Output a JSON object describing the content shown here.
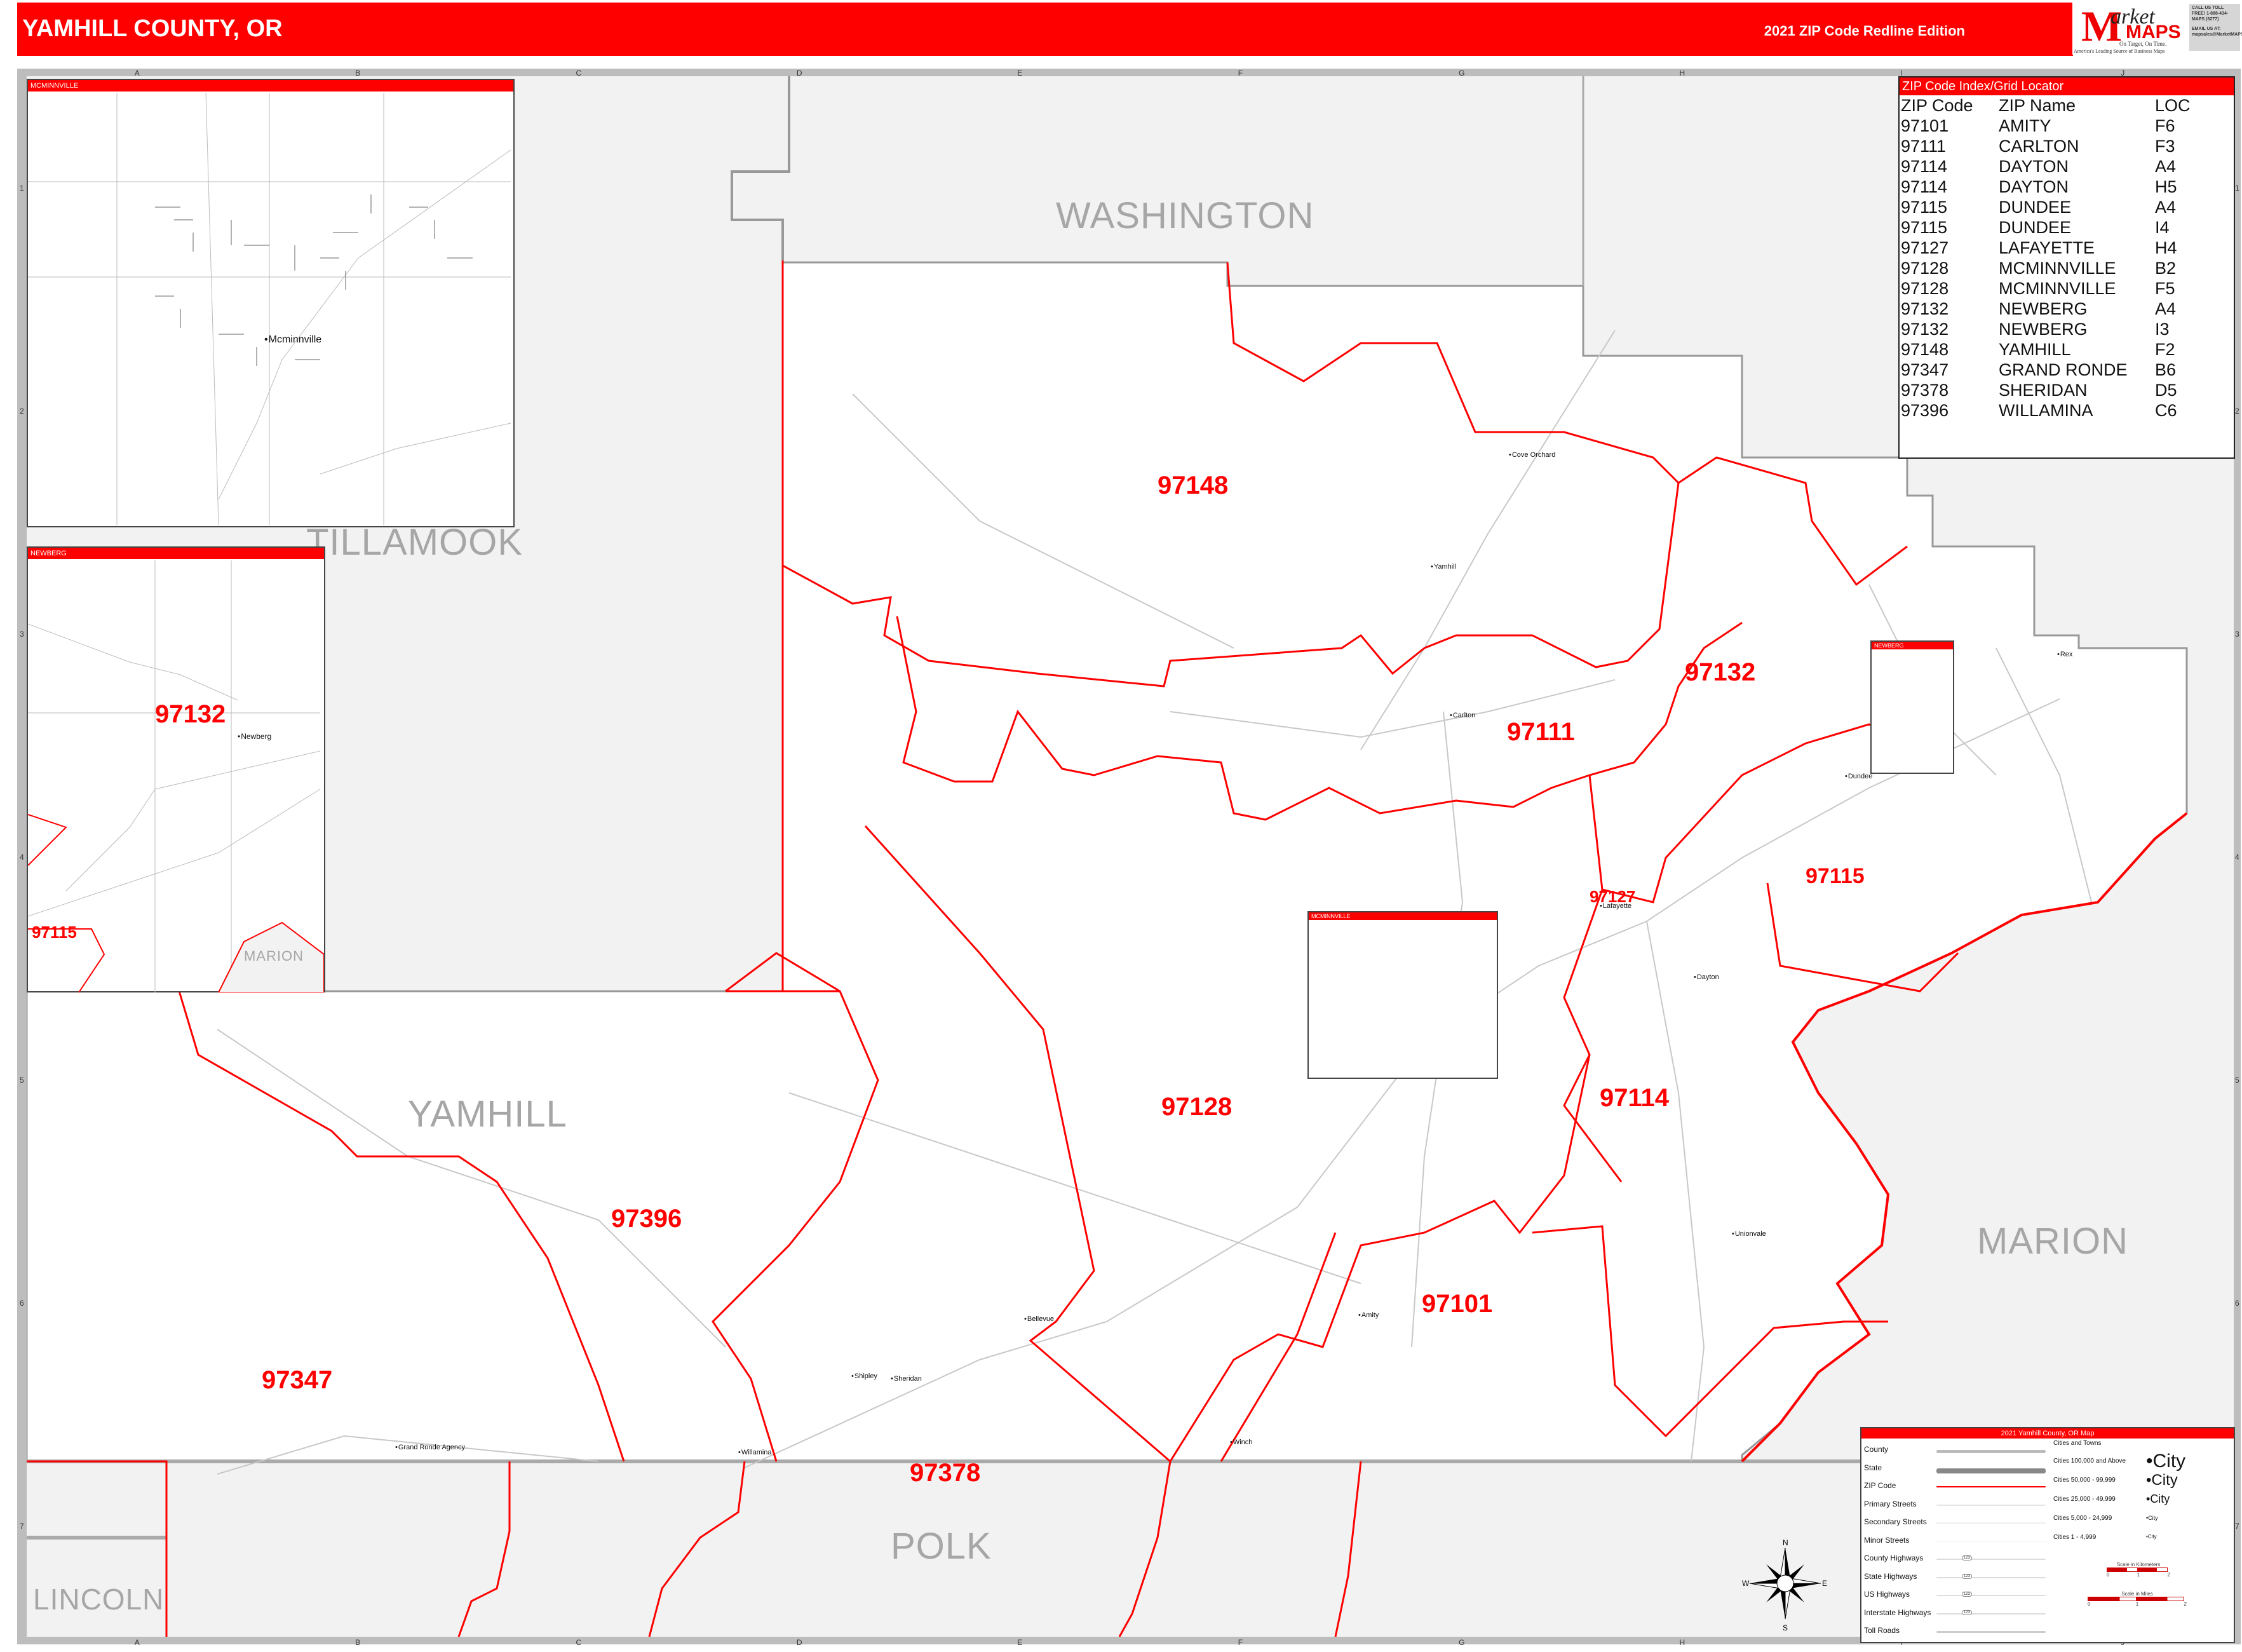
{
  "header": {
    "title": "YAMHILL COUNTY, OR",
    "edition": "2021 ZIP Code Redline Edition"
  },
  "logo": {
    "brand_m": "M",
    "brand_arket": "arket",
    "brand_maps": "MAPS",
    "tagline": "On Target, On Time.",
    "subtitle": "America's Leading Source of Business Maps",
    "contact_call": "CALL US TOLL FREE! 1-888-434-MAPS (6277)",
    "contact_email": "EMAIL US AT: mapsales@MarketMAPS.com"
  },
  "grid": {
    "columns": [
      "A",
      "B",
      "C",
      "D",
      "E",
      "F",
      "G",
      "H",
      "I",
      "J"
    ],
    "rows": [
      "1",
      "2",
      "3",
      "4",
      "5",
      "6",
      "7"
    ]
  },
  "counties": {
    "washington": "WASHINGTON",
    "tillamook": "TILLAMOOK",
    "yamhill": "YAMHILL",
    "marion": "MARION",
    "polk": "POLK",
    "lincoln": "LINCOLN",
    "marion_inset": "MARION"
  },
  "zip_labels": {
    "z97148": "97148",
    "z97132": "97132",
    "z97111": "97111",
    "z97127": "97127",
    "z97115": "97115",
    "z97128": "97128",
    "z97114": "97114",
    "z97396": "97396",
    "z97347": "97347",
    "z97101": "97101",
    "z97378": "97378",
    "inset_97132": "97132",
    "inset_97115": "97115"
  },
  "towns": {
    "cove_orchard": "Cove Orchard",
    "yamhill": "Yamhill",
    "carlton": "Carlton",
    "lafayette": "Lafayette",
    "dayton": "Dayton",
    "dundee": "Dundee",
    "rex": "Rex",
    "unionvale": "Unionvale",
    "amity": "Amity",
    "bellevue": "Bellevue",
    "sheridan": "Sheridan",
    "shipley": "Shipley",
    "willamina": "Willamina",
    "grand_ronde_agency": "Grand Ronde Agency",
    "winch": "Winch",
    "mcminnville": "Mcminnville",
    "newberg": "Newberg"
  },
  "insets": {
    "mcminnville_title": "MCMINNVILLE",
    "newberg_title": "NEWBERG",
    "mcminnville_locator": "MCMINNVILLE",
    "newberg_locator": "NEWBERG"
  },
  "zip_index": {
    "title": "ZIP Code Index/Grid Locator",
    "columns": [
      "ZIP Code",
      "ZIP Name",
      "LOC"
    ],
    "rows": [
      [
        "97101",
        "AMITY",
        "F6"
      ],
      [
        "97111",
        "CARLTON",
        "F3"
      ],
      [
        "97114",
        "DAYTON",
        "A4"
      ],
      [
        "97114",
        "DAYTON",
        "H5"
      ],
      [
        "97115",
        "DUNDEE",
        "A4"
      ],
      [
        "97115",
        "DUNDEE",
        "I4"
      ],
      [
        "97127",
        "LAFAYETTE",
        "H4"
      ],
      [
        "97128",
        "MCMINNVILLE",
        "B2"
      ],
      [
        "97128",
        "MCMINNVILLE",
        "F5"
      ],
      [
        "97132",
        "NEWBERG",
        "A4"
      ],
      [
        "97132",
        "NEWBERG",
        "I3"
      ],
      [
        "97148",
        "YAMHILL",
        "F2"
      ],
      [
        "97347",
        "GRAND RONDE",
        "B6"
      ],
      [
        "97378",
        "SHERIDAN",
        "D5"
      ],
      [
        "97396",
        "WILLAMINA",
        "C6"
      ]
    ]
  },
  "legend": {
    "title": "2021 Yamhill County, OR Map",
    "line_items": [
      "County",
      "State",
      "ZIP Code",
      "Primary Streets",
      "Secondary Streets",
      "Minor Streets",
      "County Highways",
      "State Highways",
      "US Highways",
      "Interstate Highways",
      "Toll Roads"
    ],
    "shield_text": "123",
    "cities_heading": "Cities and Towns",
    "city_classes": [
      "Cities 100,000 and Above",
      "Cities 50,000 - 99,999",
      "Cities 25,000 - 49,999",
      "Cities 5,000 - 24,999",
      "Cities 1 - 4,999"
    ],
    "city_sample": "City",
    "scale_km_label": "Scale in Kilometers",
    "scale_km_ticks": [
      "0",
      "1",
      "2"
    ],
    "scale_mi_label": "Scale in Miles",
    "scale_mi_ticks": [
      "0",
      "1",
      "2"
    ]
  },
  "compass": {
    "n": "N",
    "s": "S",
    "e": "E",
    "w": "W"
  },
  "colors": {
    "brand_red": "#ff0000",
    "county_fill": "#f2f2f2",
    "county_label": "#a6a6a6",
    "zip_line": "#ff0000"
  }
}
